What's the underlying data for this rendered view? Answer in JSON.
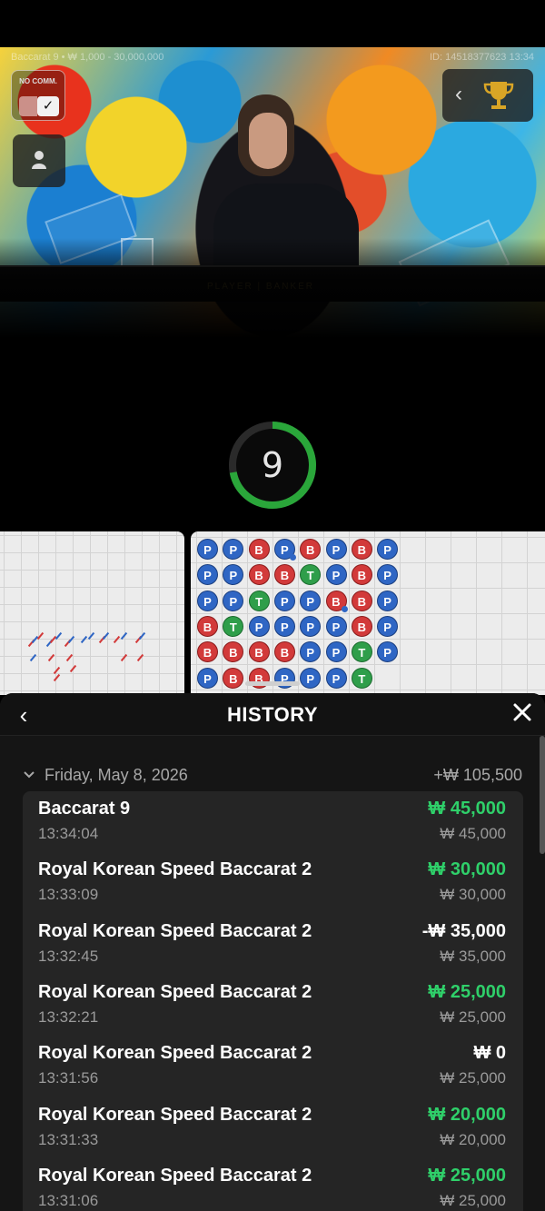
{
  "table": {
    "info_left": "Baccarat 9 • ₩ 1,000 - 30,000,000",
    "info_right": "ID: 14518377623 13:34",
    "nocomm_label": "NO COMM.",
    "nocomm_checked": true,
    "table_text": "PLAYER | BANKER"
  },
  "countdown": {
    "value": "9",
    "progress": 0.72,
    "color": "#2aa63a"
  },
  "bead_road": {
    "rows": [
      [
        "P",
        "P",
        "B",
        "P",
        "B",
        "P",
        "B",
        "P"
      ],
      [
        "P",
        "P",
        "B",
        "B",
        "T",
        "P",
        "B",
        "P"
      ],
      [
        "P",
        "P",
        "T",
        "P",
        "P",
        "B",
        "B",
        "P"
      ],
      [
        "B",
        "T",
        "P",
        "P",
        "P",
        "P",
        "B",
        "P"
      ],
      [
        "B",
        "B",
        "B",
        "B",
        "P",
        "P",
        "T",
        "P"
      ],
      [
        "P",
        "B",
        "B",
        "P",
        "P",
        "P",
        "T",
        ""
      ]
    ]
  },
  "history": {
    "title": "HISTORY",
    "day": {
      "label": "Friday, May 8, 2026",
      "total": "+₩ 105,500"
    },
    "entries": [
      {
        "game": "Baccarat 9",
        "time": "13:34:04",
        "net": "₩ 45,000",
        "stake": "₩ 45,000",
        "result": "win"
      },
      {
        "game": "Royal Korean Speed Baccarat 2",
        "time": "13:33:09",
        "net": "₩ 30,000",
        "stake": "₩ 30,000",
        "result": "win"
      },
      {
        "game": "Royal Korean Speed Baccarat 2",
        "time": "13:32:45",
        "net": "-₩ 35,000",
        "stake": "₩ 35,000",
        "result": "loss"
      },
      {
        "game": "Royal Korean Speed Baccarat 2",
        "time": "13:32:21",
        "net": "₩ 25,000",
        "stake": "₩ 25,000",
        "result": "win"
      },
      {
        "game": "Royal Korean Speed Baccarat 2",
        "time": "13:31:56",
        "net": "₩ 0",
        "stake": "₩ 25,000",
        "result": "neutral"
      },
      {
        "game": "Royal Korean Speed Baccarat 2",
        "time": "13:31:33",
        "net": "₩ 20,000",
        "stake": "₩ 20,000",
        "result": "win"
      },
      {
        "game": "Royal Korean Speed Baccarat 2",
        "time": "13:31:06",
        "net": "₩ 25,000",
        "stake": "₩ 25,000",
        "result": "win"
      }
    ]
  },
  "colors": {
    "win": "#2fd06a",
    "player": "#2f66c4",
    "banker": "#d23a3a",
    "tie": "#2f9e4a"
  },
  "icons": [
    "checkmark-icon",
    "user-icon",
    "chevron-left-icon",
    "trophy-icon",
    "close-icon",
    "chevron-down-icon"
  ]
}
